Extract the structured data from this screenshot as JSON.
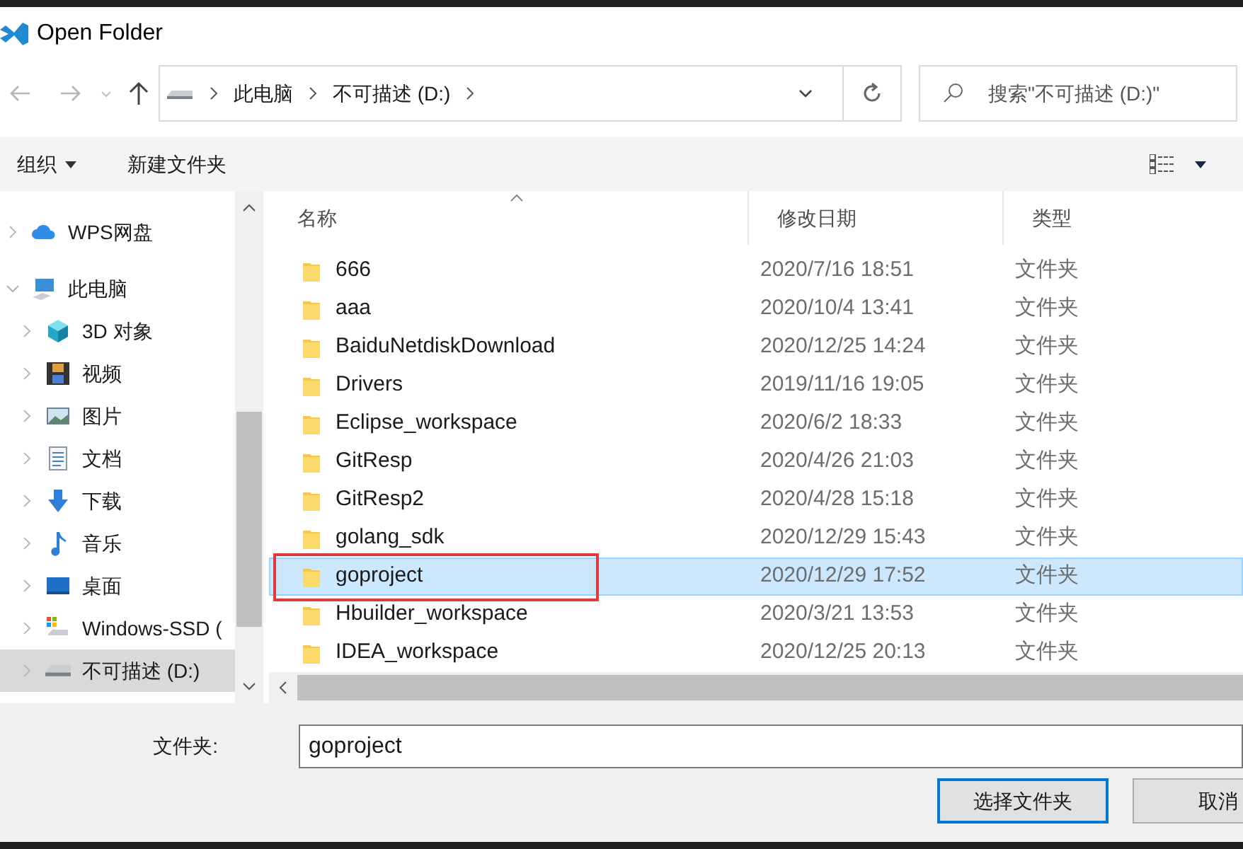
{
  "window": {
    "title": "Open Folder"
  },
  "breadcrumb": [
    "此电脑",
    "不可描述 (D:)"
  ],
  "search": {
    "placeholder": "搜索\"不可描述 (D:)\""
  },
  "toolbar": {
    "organize": "组织",
    "new_folder": "新建文件夹"
  },
  "sidebar": {
    "items": [
      {
        "label": "WPS网盘",
        "kind": "cloud",
        "selected": false
      },
      {
        "label": "此电脑",
        "kind": "pc",
        "selected": false,
        "expanded": true,
        "children": [
          {
            "label": "3D 对象",
            "kind": "cube",
            "selected": false
          },
          {
            "label": "视频",
            "kind": "film",
            "selected": false
          },
          {
            "label": "图片",
            "kind": "image",
            "selected": false
          },
          {
            "label": "文档",
            "kind": "doc",
            "selected": false
          },
          {
            "label": "下载",
            "kind": "download",
            "selected": false
          },
          {
            "label": "音乐",
            "kind": "music",
            "selected": false
          },
          {
            "label": "桌面",
            "kind": "desktop",
            "selected": false
          },
          {
            "label": "Windows-SSD (",
            "kind": "windrive",
            "selected": false
          },
          {
            "label": "不可描述 (D:)",
            "kind": "drive",
            "selected": true
          }
        ]
      }
    ]
  },
  "table": {
    "columns": [
      "名称",
      "修改日期",
      "类型"
    ],
    "rows": [
      {
        "name": "666",
        "modified": "2020/7/16 18:51",
        "type": "文件夹",
        "selected": false,
        "marked": false
      },
      {
        "name": "aaa",
        "modified": "2020/10/4 13:41",
        "type": "文件夹",
        "selected": false,
        "marked": false
      },
      {
        "name": "BaiduNetdiskDownload",
        "modified": "2020/12/25 14:24",
        "type": "文件夹",
        "selected": false,
        "marked": false
      },
      {
        "name": "Drivers",
        "modified": "2019/11/16 19:05",
        "type": "文件夹",
        "selected": false,
        "marked": false
      },
      {
        "name": "Eclipse_workspace",
        "modified": "2020/6/2 18:33",
        "type": "文件夹",
        "selected": false,
        "marked": false
      },
      {
        "name": "GitResp",
        "modified": "2020/4/26 21:03",
        "type": "文件夹",
        "selected": false,
        "marked": false
      },
      {
        "name": "GitResp2",
        "modified": "2020/4/28 15:18",
        "type": "文件夹",
        "selected": false,
        "marked": false
      },
      {
        "name": "golang_sdk",
        "modified": "2020/12/29 15:43",
        "type": "文件夹",
        "selected": false,
        "marked": false
      },
      {
        "name": "goproject",
        "modified": "2020/12/29 17:52",
        "type": "文件夹",
        "selected": true,
        "marked": true
      },
      {
        "name": "Hbuilder_workspace",
        "modified": "2020/3/21 13:53",
        "type": "文件夹",
        "selected": false,
        "marked": false
      },
      {
        "name": "IDEA_workspace",
        "modified": "2020/12/25 20:13",
        "type": "文件夹",
        "selected": false,
        "marked": false
      }
    ]
  },
  "folder_field": {
    "label": "文件夹:",
    "value": "goproject"
  },
  "buttons": [
    "选择文件夹",
    "取消"
  ]
}
